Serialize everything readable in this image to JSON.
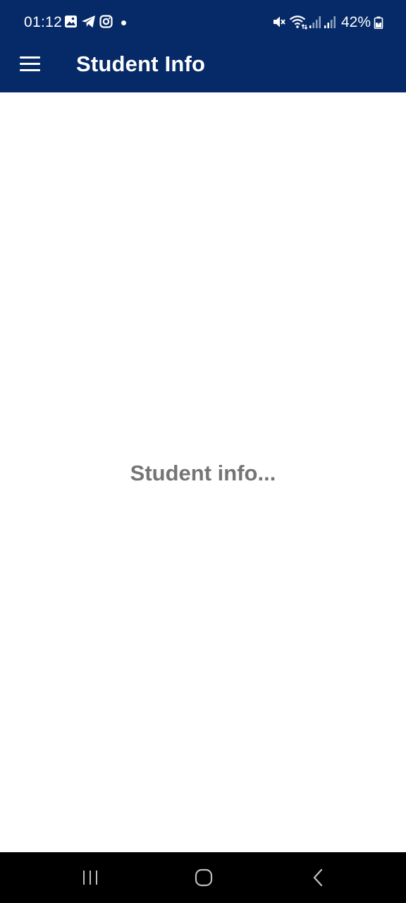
{
  "status_bar": {
    "time": "01:12",
    "battery": "42%",
    "notification_icons": [
      "gallery-icon",
      "telegram-icon",
      "instagram-icon",
      "more-dot-icon"
    ],
    "system_icons": [
      "mute-icon",
      "wifi-icon",
      "signal-icon",
      "signal-icon",
      "battery-icon"
    ]
  },
  "app_bar": {
    "title": "Student Info",
    "menu_icon": "hamburger-menu-icon",
    "background_color": "#062a67"
  },
  "content": {
    "placeholder_text": "Student info...",
    "text_color": "#757575"
  },
  "nav_bar": {
    "items": [
      "recents-icon",
      "home-icon",
      "back-icon"
    ]
  }
}
